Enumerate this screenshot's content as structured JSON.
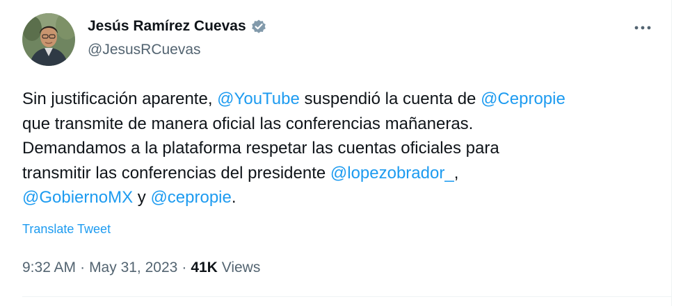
{
  "author": {
    "name": "Jesús Ramírez Cuevas",
    "handle": "@JesusRCuevas",
    "verified_color": "#829aab",
    "avatar_icon": "profile-photo"
  },
  "menu": {
    "more_icon": "more-horizontal-icon",
    "more_glyph": "•••"
  },
  "tweet": {
    "lines": [
      {
        "p1": "Sin justificación aparente, ",
        "m1": "@YouTube",
        "p2": " suspendió la cuenta de ",
        "m2": "@Cepropie"
      },
      {
        "p1": "que transmite de manera oficial las conferencias mañaneras."
      },
      {
        "p1": "Demandamos a la plataforma respetar las cuentas oficiales para"
      },
      {
        "p1": "transmitir las conferencias del presidente ",
        "m1": "@lopezobrador_",
        "p2": ","
      },
      {
        "m1": "@GobiernoMX",
        "p1": " y ",
        "m2": "@cepropie",
        "p2": "."
      }
    ]
  },
  "translate_label": "Translate Tweet",
  "meta": {
    "time": "9:32 AM",
    "separator": "·",
    "date": "May 31, 2023",
    "views_count": "41K",
    "views_label": "Views"
  },
  "colors": {
    "link": "#1d9bf0",
    "text": "#0f1419",
    "secondary": "#536471",
    "divider": "#eff3f4"
  }
}
